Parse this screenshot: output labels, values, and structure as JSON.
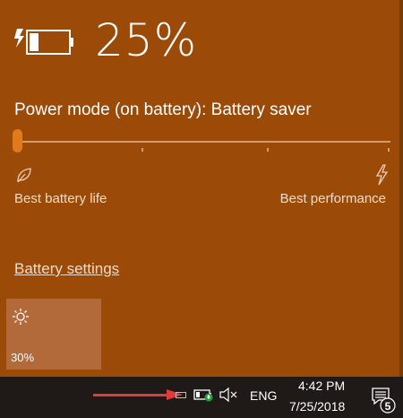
{
  "battery": {
    "percent_text": "25%",
    "power_mode_label": "Power mode (on battery): Battery saver",
    "slider_level": 0,
    "left_label": "Best battery life",
    "right_label": "Best performance",
    "settings_link": "Battery settings"
  },
  "brightness_tile": {
    "value": "30%",
    "icon": "sun-icon"
  },
  "taskbar": {
    "language": "ENG",
    "time": "4:42 PM",
    "date": "7/25/2018",
    "notification_count": "5"
  },
  "colors": {
    "flyout_bg": "#9c4a07",
    "accent": "#e07a1c",
    "tile_bg": "#b36a3a",
    "arrow": "#e03a3a",
    "taskbar_bg": "#1f1a17"
  }
}
